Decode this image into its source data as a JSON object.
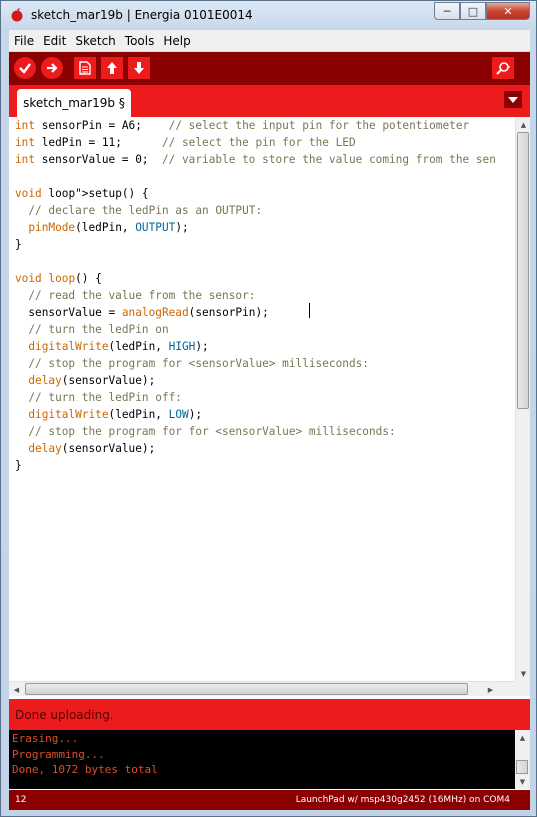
{
  "window": {
    "title": "sketch_mar19b | Energia 0101E0014",
    "controls": {
      "minimize": "─",
      "maximize": "□",
      "close": "✕"
    }
  },
  "menu": [
    "File",
    "Edit",
    "Sketch",
    "Tools",
    "Help"
  ],
  "toolbar": {
    "buttons": [
      {
        "name": "verify-button",
        "icon": "check-icon"
      },
      {
        "name": "upload-button",
        "icon": "arrow-right-icon"
      },
      {
        "name": "new-button",
        "icon": "new-file-icon"
      },
      {
        "name": "open-button",
        "icon": "arrow-up-icon"
      },
      {
        "name": "save-button",
        "icon": "arrow-down-icon"
      },
      {
        "name": "serial-monitor-button",
        "icon": "magnifier-icon"
      }
    ]
  },
  "tabs": [
    {
      "label": "sketch_mar19b §",
      "active": true
    }
  ],
  "editor": {
    "lines": [
      "int sensorPin = A6;    // select the input pin for the potentiometer",
      "int ledPin = 11;      // select the pin for the LED",
      "int sensorValue = 0;  // variable to store the value coming from the sen",
      "",
      "void setup() {",
      "  // declare the ledPin as an OUTPUT:",
      "  pinMode(ledPin, OUTPUT);",
      "}",
      "",
      "void loop() {",
      "  // read the value from the sensor:",
      "  sensorValue = analogRead(sensorPin);",
      "  // turn the ledPin on",
      "  digitalWrite(ledPin, HIGH);",
      "  // stop the program for <sensorValue> milliseconds:",
      "  delay(sensorValue);",
      "  // turn the ledPin off:",
      "  digitalWrite(ledPin, LOW);",
      "  // stop the program for for <sensorValue> milliseconds:",
      "  delay(sensorValue);",
      "}"
    ]
  },
  "status": {
    "message": "Done uploading."
  },
  "console": {
    "lines": [
      "Erasing...",
      "Programming...",
      "Done, 1072 bytes total"
    ]
  },
  "footer": {
    "line_number": "12",
    "board": "LaunchPad w/ msp430g2452 (16MHz) on COM4"
  },
  "colors": {
    "accent_red": "#ed1c1c",
    "dark_red": "#8b0000",
    "keyword": "#cc6600",
    "comment": "#777755",
    "constant": "#006699",
    "console_text": "#e34c26"
  }
}
